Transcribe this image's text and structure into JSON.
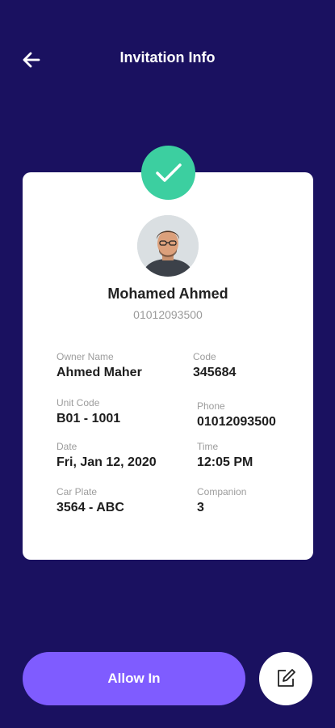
{
  "header": {
    "title": "Invitation Info",
    "back_icon": "arrow-left-icon"
  },
  "status": {
    "icon": "check-icon",
    "color": "#3ccfa0"
  },
  "guest": {
    "name": "Mohamed Ahmed",
    "phone": "01012093500"
  },
  "details": [
    {
      "label": "Owner Name",
      "value": "Ahmed Maher"
    },
    {
      "label": "Code",
      "value": "345684"
    },
    {
      "label": "Unit Code",
      "value": "B01 - 1001"
    },
    {
      "label": "Phone",
      "value": "01012093500"
    },
    {
      "label": "Date",
      "value": "Fri, Jan 12, 2020"
    },
    {
      "label": "Time",
      "value": "12:05 PM"
    },
    {
      "label": "Car Plate",
      "value": "3564 - ABC"
    },
    {
      "label": "Companion",
      "value": "3"
    }
  ],
  "actions": {
    "allow_label": "Allow In",
    "edit_icon": "edit-icon"
  },
  "colors": {
    "background": "#1a1160",
    "accent": "#7f5cff",
    "success": "#3ccfa0"
  }
}
